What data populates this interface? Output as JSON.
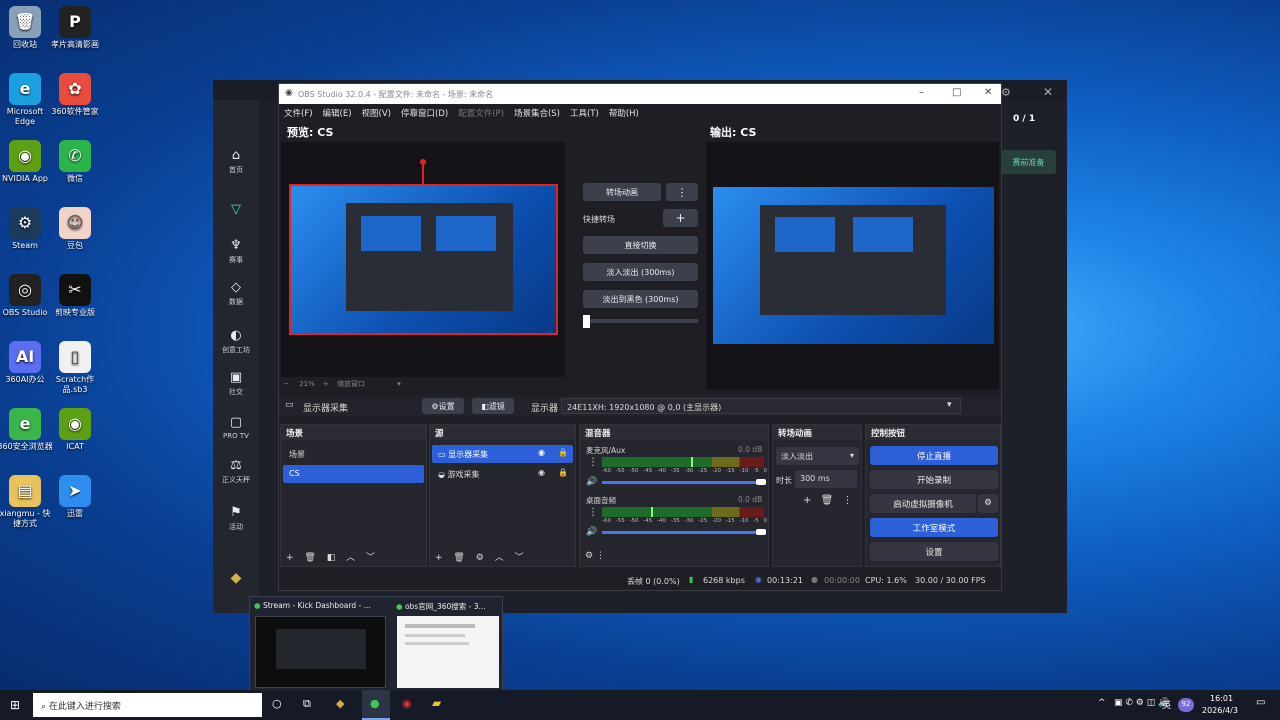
{
  "desktop_icons": [
    {
      "label": "回收站",
      "icon": "recycle-bin-icon",
      "color": "#8aa0b8",
      "glyph": "🗑"
    },
    {
      "label": "孝片高清影画",
      "icon": "player-icon",
      "color": "#222",
      "glyph": "P"
    },
    {
      "label": "Microsoft Edge",
      "icon": "edge-icon",
      "color": "#1aa0e0",
      "glyph": "e"
    },
    {
      "label": "360软件管家",
      "icon": "360-manager-icon",
      "color": "#e94b3c",
      "glyph": "✿"
    },
    {
      "label": "NVIDIA App",
      "icon": "nvidia-icon",
      "color": "#5ea014",
      "glyph": "◉"
    },
    {
      "label": "微信",
      "icon": "wechat-icon",
      "color": "#2bb44a",
      "glyph": "✆"
    },
    {
      "label": "Steam",
      "icon": "steam-icon",
      "color": "#1b3a5c",
      "glyph": "⚙"
    },
    {
      "label": "豆包",
      "icon": "doubao-icon",
      "color": "#f3d2c8",
      "glyph": "☺"
    },
    {
      "label": "OBS Studio",
      "icon": "obs-icon",
      "color": "#222",
      "glyph": "◎"
    },
    {
      "label": "剪映专业版",
      "icon": "capcut-icon",
      "color": "#111",
      "glyph": "✂"
    },
    {
      "label": "360AI办公",
      "icon": "360ai-icon",
      "color": "#5b6df0",
      "glyph": "AI"
    },
    {
      "label": "Scratch作品.sb3",
      "icon": "file-icon",
      "color": "#f1f1f1",
      "glyph": "▯"
    },
    {
      "label": "360安全浏览器",
      "icon": "360-browser-icon",
      "color": "#3ab54a",
      "glyph": "e"
    },
    {
      "label": "ICAT",
      "icon": "icat-icon",
      "color": "#5ea014",
      "glyph": "◉"
    },
    {
      "label": "xiangmu - 快捷方式",
      "icon": "folder-shortcut-icon",
      "color": "#e8c25a",
      "glyph": "▤"
    },
    {
      "label": "迅雷",
      "icon": "thunder-icon",
      "color": "#2f8df0",
      "glyph": "➤"
    }
  ],
  "host": {
    "nav": [
      {
        "label": "首页",
        "icon": "home-icon",
        "glyph": "⌂"
      },
      {
        "label": "",
        "icon": "shield-icon",
        "glyph": "▽"
      },
      {
        "label": "赛事",
        "icon": "trophy-icon",
        "glyph": "♆"
      },
      {
        "label": "数据",
        "icon": "data-icon",
        "glyph": "◇"
      },
      {
        "label": "创意工坊",
        "icon": "workshop-icon",
        "glyph": "◐"
      },
      {
        "label": "社交",
        "icon": "social-icon",
        "glyph": "▣"
      },
      {
        "label": "PRO TV",
        "icon": "tv-icon",
        "glyph": "▢"
      },
      {
        "label": "正义天秤",
        "icon": "scale-icon",
        "glyph": "⚖"
      },
      {
        "label": "活动",
        "icon": "gift-icon",
        "glyph": "⚑"
      }
    ],
    "counter": "0 / 1",
    "ready_label": "赛前准备"
  },
  "obs": {
    "title": "OBS Studio 32.0.4 - 配置文件: 未命名 - 场景: 未命名",
    "menu": [
      "文件(F)",
      "编辑(E)",
      "视图(V)",
      "停靠窗口(D)",
      "配置文件(P)",
      "场景集合(S)",
      "工具(T)",
      "帮助(H)"
    ],
    "preview_label": "预览: CS",
    "output_label": "输出: CS",
    "zoom": "21%",
    "zoom_mode": "缩放窗口",
    "transition": {
      "button": "转场动画",
      "quick": "快捷转场",
      "cut": "直接切换",
      "fade": "淡入淡出 (300ms)",
      "fade_black": "淡出到黑色 (300ms)"
    },
    "source_bar": {
      "name": "显示器采集",
      "settings": "设置",
      "filters": "滤镜",
      "display_label": "显示器",
      "display_value": "24E11XH: 1920x1080 @ 0,0 (主显示器)"
    },
    "scenes": {
      "title": "场景",
      "items": [
        "场景",
        "CS"
      ],
      "selected": 1
    },
    "sources": {
      "title": "源",
      "items": [
        "显示器采集",
        "游戏采集"
      ],
      "selected": 0
    },
    "mixer": {
      "title": "混音器",
      "channels": [
        {
          "name": "麦克风/Aux",
          "db": "0.0 dB",
          "level": 0.55
        },
        {
          "name": "桌面音频",
          "db": "0.0 dB",
          "level": 0.3
        }
      ],
      "scale": [
        "-60",
        "-55",
        "-50",
        "-45",
        "-40",
        "-35",
        "-30",
        "-25",
        "-20",
        "-15",
        "-10",
        "-5",
        "0"
      ]
    },
    "transitions": {
      "title": "转场动画",
      "current": "淡入淡出",
      "duration_label": "时长",
      "duration": "300 ms"
    },
    "controls": {
      "title": "控制按钮",
      "stop_stream": "停止直播",
      "start_rec": "开始录制",
      "virtual_cam": "启动虚拟摄像机",
      "studio": "工作室模式",
      "settings": "设置"
    },
    "status": {
      "dropped": "丢帧 0 (0.0%)",
      "bitrate": "6268 kbps",
      "stream_time": "00:13:21",
      "rec_time": "00:00:00",
      "cpu": "CPU: 1.6%",
      "fps": "30.00 / 30.00 FPS"
    }
  },
  "task_previews": [
    {
      "title": "Stream - Kick Dashboard - ..."
    },
    {
      "title": "obs官网_360搜索 - 3..."
    }
  ],
  "taskbar": {
    "search_placeholder": "在此键入进行搜索",
    "lang": "英",
    "time": "16:01",
    "date": "2026/4/3",
    "badge": "92"
  }
}
